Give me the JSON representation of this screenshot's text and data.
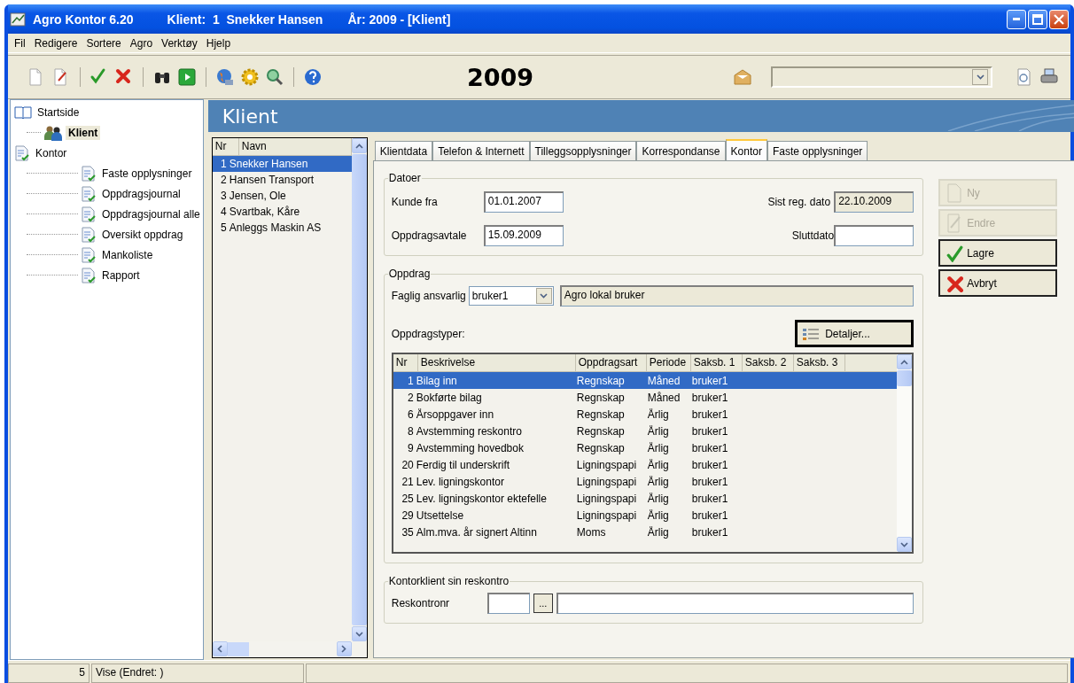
{
  "window": {
    "title": "Agro Kontor 6.20",
    "client": "Klient:  1  Snekker Hansen",
    "year_title": "År: 2009 - [Klient]"
  },
  "menu": [
    "Fil",
    "Redigere",
    "Sortere",
    "Agro",
    "Verktøy",
    "Hjelp"
  ],
  "toolbar": {
    "year": "2009"
  },
  "tree": [
    {
      "label": "Startside",
      "kind": "book",
      "selected": false,
      "children": [
        {
          "label": "Klient",
          "kind": "clients",
          "selected": true
        }
      ]
    },
    {
      "label": "Kontor",
      "kind": "report",
      "selected": false,
      "children": [
        {
          "label": "Faste opplysninger",
          "kind": "report",
          "selected": false
        },
        {
          "label": "Oppdragsjournal",
          "kind": "report",
          "selected": false
        },
        {
          "label": "Oppdragsjournal alle",
          "kind": "report",
          "selected": false
        },
        {
          "label": "Oversikt oppdrag",
          "kind": "report",
          "selected": false
        },
        {
          "label": "Mankoliste",
          "kind": "report",
          "selected": false
        },
        {
          "label": "Rapport",
          "kind": "report",
          "selected": false
        }
      ]
    }
  ],
  "header": "Klient",
  "client_list": {
    "columns": [
      "Nr",
      "Navn"
    ],
    "rows": [
      {
        "nr": "1",
        "name": "Snekker Hansen",
        "selected": true
      },
      {
        "nr": "2",
        "name": "Hansen Transport",
        "selected": false
      },
      {
        "nr": "3",
        "name": "Jensen, Ole",
        "selected": false
      },
      {
        "nr": "4",
        "name": "Svartbak, Kåre",
        "selected": false
      },
      {
        "nr": "5",
        "name": "Anleggs Maskin AS",
        "selected": false
      }
    ]
  },
  "tabs": [
    {
      "label": "Klientdata",
      "selected": false
    },
    {
      "label": "Telefon & Internett",
      "selected": false
    },
    {
      "label": "Tilleggsopplysninger",
      "selected": false
    },
    {
      "label": "Korrespondanse",
      "selected": false
    },
    {
      "label": "Kontor",
      "selected": true
    },
    {
      "label": "Faste opplysninger",
      "selected": false
    }
  ],
  "datoer": {
    "title": "Datoer",
    "fields": [
      {
        "label": "Kunde fra",
        "value": "01.01.2007",
        "disabled": false
      },
      {
        "label": "Sist reg. dato",
        "value": "22.10.2009",
        "disabled": true
      },
      {
        "label": "Oppdragsavtale",
        "value": "15.09.2009",
        "disabled": false
      },
      {
        "label": "Sluttdato",
        "disabled": false
      }
    ]
  },
  "actions": [
    {
      "label": "Ny",
      "kind": "new",
      "disabled": true
    },
    {
      "label": "Endre",
      "kind": "edit",
      "disabled": true
    },
    {
      "label": "Lagre",
      "kind": "save",
      "disabled": false
    },
    {
      "label": "Avbryt",
      "kind": "cancel",
      "disabled": false
    }
  ],
  "oppdrag": {
    "title": "Oppdrag",
    "responsible_label": "Faglig ansvarlig",
    "responsible_value": "bruker1",
    "responsible_name": "Agro lokal bruker",
    "types_label": "Oppdragstyper:",
    "details_button": "Detaljer...",
    "columns": [
      "Nr",
      "Beskrivelse",
      "Oppdragsart",
      "Periode",
      "Saksb. 1",
      "Saksb. 2",
      "Saksb. 3"
    ],
    "rows": [
      {
        "cells": [
          "1",
          "Bilag inn",
          "Regnskap",
          "Måned",
          "bruker1"
        ],
        "selected": true
      },
      {
        "cells": [
          "2",
          "Bokførte bilag",
          "Regnskap",
          "Måned",
          "bruker1"
        ],
        "selected": false
      },
      {
        "cells": [
          "6",
          "Årsoppgaver inn",
          "Regnskap",
          "Årlig",
          "bruker1"
        ],
        "selected": false
      },
      {
        "cells": [
          "8",
          "Avstemming reskontro",
          "Regnskap",
          "Årlig",
          "bruker1"
        ],
        "selected": false
      },
      {
        "cells": [
          "9",
          "Avstemming hovedbok",
          "Regnskap",
          "Årlig",
          "bruker1"
        ],
        "selected": false
      },
      {
        "cells": [
          "20",
          "Ferdig til underskrift",
          "Ligningspapi",
          "Årlig",
          "bruker1"
        ],
        "selected": false
      },
      {
        "cells": [
          "21",
          "Lev. ligningskontor",
          "Ligningspapi",
          "Årlig",
          "bruker1"
        ],
        "selected": false
      },
      {
        "cells": [
          "25",
          "Lev. ligningskontor ektefelle",
          "Ligningspapi",
          "Årlig",
          "bruker1"
        ],
        "selected": false
      },
      {
        "cells": [
          "29",
          "Utsettelse",
          "Ligningspapi",
          "Årlig",
          "bruker1"
        ],
        "selected": false
      },
      {
        "cells": [
          "35",
          "Alm.mva. år signert Altinn",
          "Moms",
          "Årlig",
          "bruker1"
        ],
        "selected": false
      }
    ]
  },
  "reskontro": {
    "title": "Kontorklient sin reskontro",
    "label": "Reskontronr",
    "button": "..."
  },
  "status_bar": [
    "5",
    "Vise (Endret: )"
  ]
}
